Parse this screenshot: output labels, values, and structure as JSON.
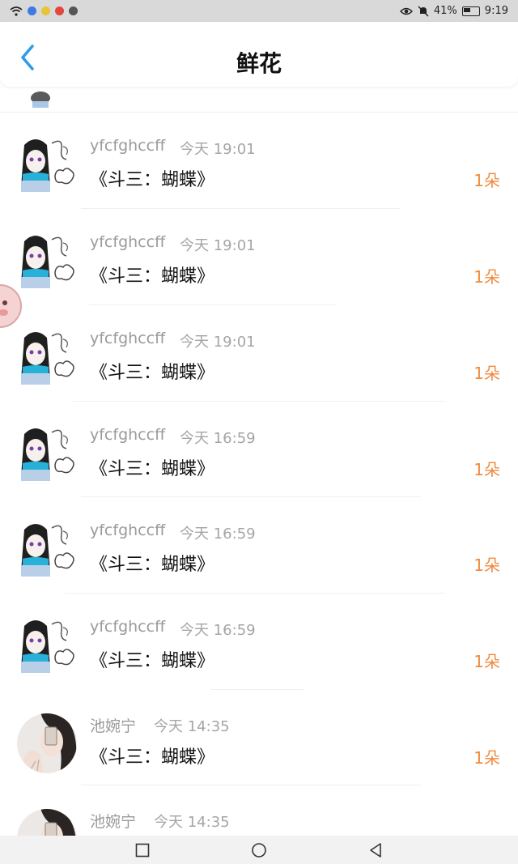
{
  "status_bar": {
    "battery_pct": "41%",
    "time": "9:19",
    "left_icons": [
      "wifi-icon",
      "browser-icon",
      "baidu-icon",
      "weibo-icon",
      "wechat-icon"
    ],
    "right_icons": [
      "eye-icon",
      "mute-icon",
      "battery-icon"
    ]
  },
  "header": {
    "title": "鲜花",
    "back_icon": "chevron-left-icon"
  },
  "colors": {
    "accent_blue": "#2b9de9",
    "count_orange": "#f08a3c",
    "name_gray": "#9a9a9a"
  },
  "records": [
    {
      "user": "yfcfghccff",
      "time": "今天 19:01",
      "gift": "《斗三：蝴蝶》",
      "count": "1朵",
      "avatar": "anime"
    },
    {
      "user": "yfcfghccff",
      "time": "今天 19:01",
      "gift": "《斗三：蝴蝶》",
      "count": "1朵",
      "avatar": "anime"
    },
    {
      "user": "yfcfghccff",
      "time": "今天 19:01",
      "gift": "《斗三：蝴蝶》",
      "count": "1朵",
      "avatar": "anime"
    },
    {
      "user": "yfcfghccff",
      "time": "今天 16:59",
      "gift": "《斗三：蝴蝶》",
      "count": "1朵",
      "avatar": "anime"
    },
    {
      "user": "yfcfghccff",
      "time": "今天 16:59",
      "gift": "《斗三：蝴蝶》",
      "count": "1朵",
      "avatar": "anime"
    },
    {
      "user": "yfcfghccff",
      "time": "今天 16:59",
      "gift": "《斗三：蝴蝶》",
      "count": "1朵",
      "avatar": "anime"
    },
    {
      "user": "池婉宁",
      "time": "今天 14:35",
      "gift": "《斗三：蝴蝶》",
      "count": "1朵",
      "avatar": "photo"
    },
    {
      "user": "池婉宁",
      "time": "今天 14:35",
      "gift": "",
      "count": "",
      "avatar": "photo"
    }
  ],
  "navbar": {
    "icons": [
      "square-icon",
      "circle-icon",
      "triangle-back-icon"
    ]
  }
}
